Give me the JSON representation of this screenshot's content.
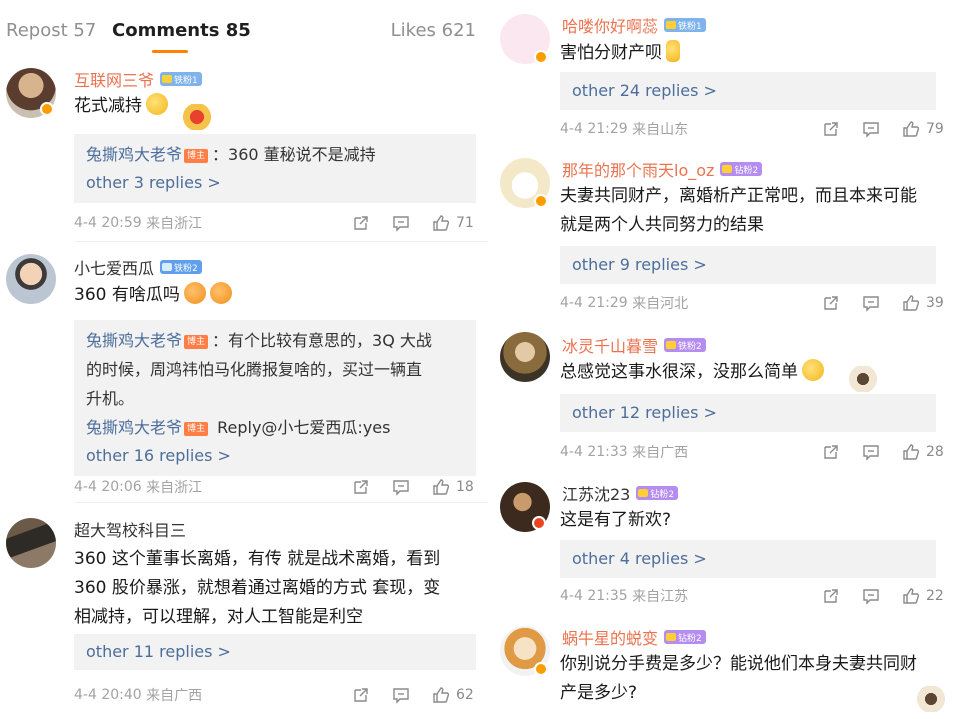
{
  "tabs": {
    "repost": "Repost 57",
    "comments": "Comments 85",
    "likes": "Likes 621"
  },
  "colors": {
    "accent": "#ff8200",
    "username": "#eb7350",
    "link": "#4c6e9c"
  },
  "comments_left": [
    {
      "user": "互联网三爷",
      "badge": "铁粉1",
      "text": "花式减持",
      "reply_lines": [
        {
          "name": "兔撕鸡大老爷",
          "host": "博主",
          "body": "：360 董秘说不是减持"
        }
      ],
      "other": "other 3 replies >",
      "time": "4-4 20:59",
      "source": "来自浙江",
      "likes": "71"
    },
    {
      "user": "小七爱西瓜",
      "badge": "铁粉2",
      "text": "360 有啥瓜吗",
      "reply_lines": [
        {
          "name": "兔撕鸡大老爷",
          "host": "博主",
          "body": "：有个比较有意思的，3Q 大战"
        },
        {
          "body": "的时候，周鸿祎怕马化腾报复啥的，买过一辆直"
        },
        {
          "body": "升机。"
        },
        {
          "name": "兔撕鸡大老爷",
          "host": "博主",
          "body": " Reply@小七爱西瓜:yes"
        }
      ],
      "other": "other 16 replies >",
      "time": "4-4 20:06",
      "source": "来自浙江",
      "likes": "18"
    },
    {
      "user": "超大驾校科目三",
      "text_lines": [
        "360 这个董事长离婚，有传 就是战术离婚，看到",
        "360 股价暴涨，就想着通过离婚的方式 套现，变",
        "相减持，可以理解，对人工智能是利空"
      ],
      "other": "other 11 replies >",
      "time": "4-4 20:40",
      "source": "来自广西",
      "likes": "62"
    }
  ],
  "comments_right": [
    {
      "user": "哈喽你好啊蕊",
      "badge": "铁粉1",
      "text": "害怕分财产呗",
      "other": "other 24 replies >",
      "time": "4-4 21:29",
      "source": "来自山东",
      "likes": "79"
    },
    {
      "user": "那年的那个雨天lo_oz",
      "badge": "钻粉2",
      "text_lines": [
        "夫妻共同财产，离婚析产正常吧，而且本来可能",
        "就是两个人共同努力的结果"
      ],
      "other": "other 9 replies >",
      "time": "4-4 21:29",
      "source": "来自河北",
      "likes": "39"
    },
    {
      "user": "冰灵千山暮雪",
      "badge": "铁粉2",
      "text": "总感觉这事水很深，没那么简单",
      "other": "other 12 replies >",
      "time": "4-4 21:33",
      "source": "来自广西",
      "likes": "28"
    },
    {
      "user": "江苏沈23",
      "badge": "钻粉2",
      "text": "这是有了新欢?",
      "other": "other 4 replies >",
      "time": "4-4 21:35",
      "source": "来自江苏",
      "likes": "22"
    },
    {
      "user": "蜗牛星的蜕变",
      "badge": "钻粉2",
      "text_lines": [
        "你别说分手费是多少？能说他们本身夫妻共同财",
        "产是多少?"
      ]
    }
  ]
}
